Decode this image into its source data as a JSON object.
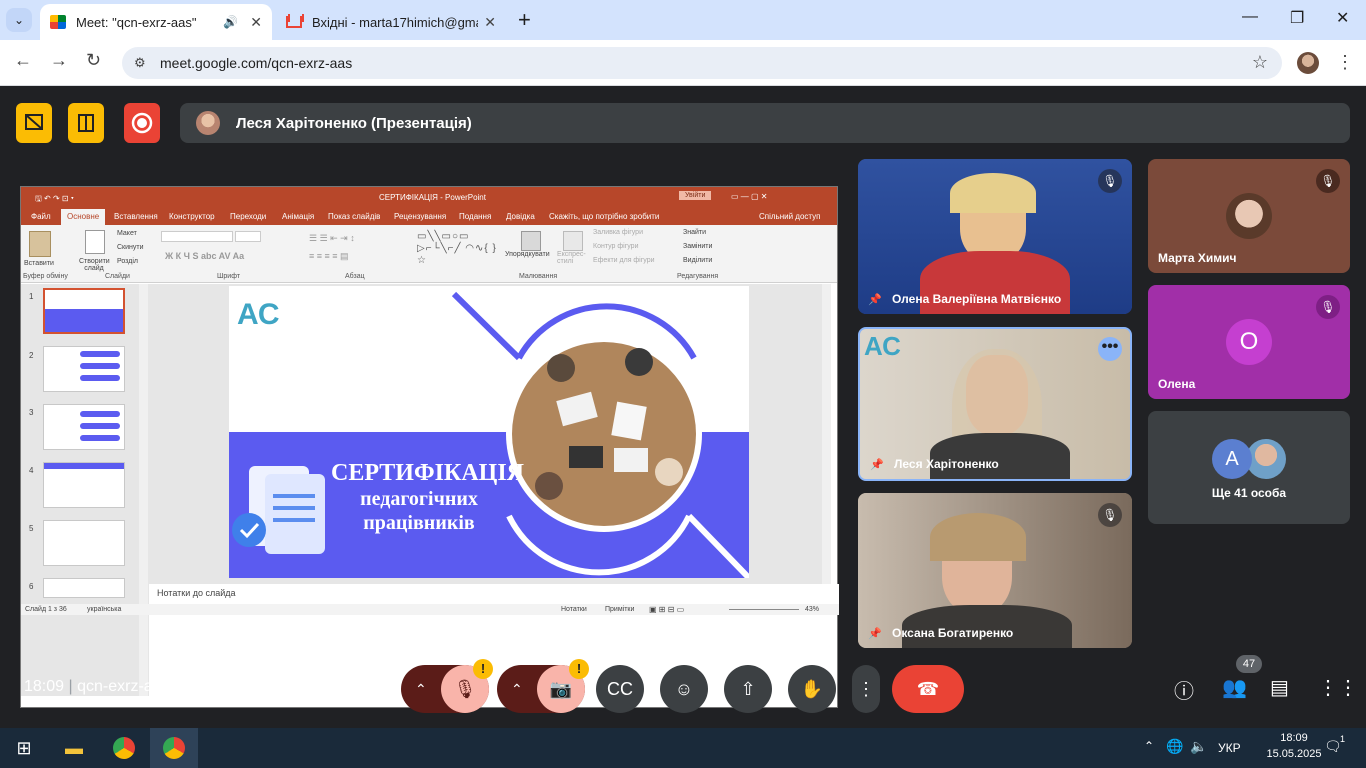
{
  "browser": {
    "tabs": [
      {
        "title": "Meet: \"qcn-exrz-aas\""
      },
      {
        "title": "Вхідні - marta17himich@gmail."
      }
    ],
    "url": "meet.google.com/qcn-exrz-aas"
  },
  "meet": {
    "presenter_bar": "Леся Харітоненко (Презентація)",
    "participants": [
      {
        "name": "Олена Валеріївна Матвієнко",
        "muted": true
      },
      {
        "name": "Марта Химич",
        "muted": true
      },
      {
        "name": "Леся Харітоненко",
        "muted": false
      },
      {
        "name": "Олена",
        "initial": "О",
        "muted": true
      },
      {
        "name": "Оксана Богатиренко",
        "muted": true
      }
    ],
    "others": {
      "label": "Ще 41 особа",
      "initial": "А"
    },
    "time": "18:09",
    "meeting_code": "qcn-exrz-aas",
    "people_count": "47",
    "warning_badge": "!"
  },
  "ppt": {
    "title": "СЕРТИФІКАЦІЯ  -  PowerPoint",
    "login": "Увійти",
    "tabs": [
      "Файл",
      "Основне",
      "Вставлення",
      "Конструктор",
      "Переходи",
      "Анімація",
      "Показ слайдів",
      "Рецензування",
      "Подання",
      "Довідка",
      "Скажіть, що потрібно зробити",
      "Спільний доступ"
    ],
    "groups": [
      "Буфер обміну",
      "Слайди",
      "Шрифт",
      "Абзац",
      "Малювання",
      "Редагування"
    ],
    "ribbon_items": {
      "paste": "Вставити",
      "create": "Створити слайд",
      "layout": "Макет",
      "reset": "Скинути",
      "section": "Розділ",
      "arrange": "Упорядкувати",
      "express": "Експрес-стилі",
      "fill": "Заливка фігури",
      "outline": "Контур фігури",
      "effects": "Ефекти для фігури",
      "find": "Знайти",
      "replace": "Замінити",
      "select": "Виділити"
    },
    "slide_numbers": [
      "1",
      "2",
      "3",
      "4",
      "5",
      "6"
    ],
    "slide": {
      "logo": "АС",
      "line1": "СЕРТИФІКАЦІЯ",
      "line2": "педагогічних",
      "line3": "працівників"
    },
    "notes": "Нотатки до слайда",
    "status": {
      "slide": "Слайд 1 з 36",
      "lang": "українська",
      "notes": "Нотатки",
      "comments": "Примітки",
      "zoom": "43%"
    }
  },
  "taskbar": {
    "lang": "УКР",
    "time": "18:09",
    "date": "15.05.2025",
    "notif": "1"
  }
}
